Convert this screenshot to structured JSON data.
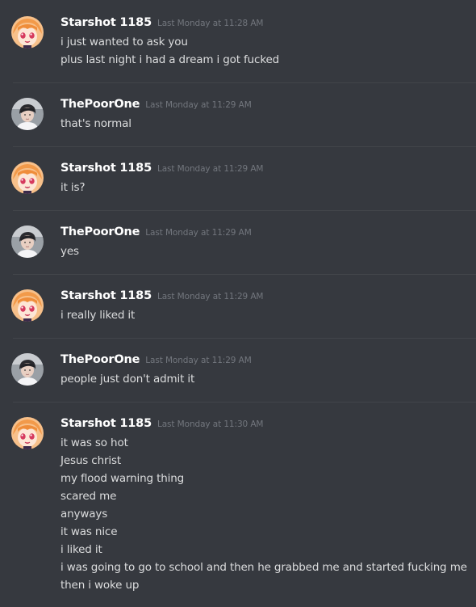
{
  "messages": [
    {
      "user": "Starshot 1185",
      "avatar": "anime-girl-avatar-icon",
      "timestamp": "Last Monday at 11:28 AM",
      "lines": [
        "i just wanted to ask you",
        "plus last night i had a dream i got fucked"
      ]
    },
    {
      "user": "ThePoorOne",
      "avatar": "boy-photo-avatar-icon",
      "timestamp": "Last Monday at 11:29 AM",
      "lines": [
        "that's normal"
      ]
    },
    {
      "user": "Starshot 1185",
      "avatar": "anime-girl-avatar-icon",
      "timestamp": "Last Monday at 11:29 AM",
      "lines": [
        "it is?"
      ]
    },
    {
      "user": "ThePoorOne",
      "avatar": "boy-photo-avatar-icon",
      "timestamp": "Last Monday at 11:29 AM",
      "lines": [
        "yes"
      ]
    },
    {
      "user": "Starshot 1185",
      "avatar": "anime-girl-avatar-icon",
      "timestamp": "Last Monday at 11:29 AM",
      "lines": [
        "i really liked it"
      ]
    },
    {
      "user": "ThePoorOne",
      "avatar": "boy-photo-avatar-icon",
      "timestamp": "Last Monday at 11:29 AM",
      "lines": [
        "people just don't admit it"
      ]
    },
    {
      "user": "Starshot 1185",
      "avatar": "anime-girl-avatar-icon",
      "timestamp": "Last Monday at 11:30 AM",
      "lines": [
        "it was so hot",
        "Jesus christ",
        "my flood warning thing",
        "scared me",
        "anyways",
        "it was nice",
        "i liked it",
        "i was going to go to school and then he grabbed me and started fucking me",
        "then i woke up"
      ]
    }
  ],
  "colors": {
    "background": "#36393f",
    "divider": "#42454a",
    "username": "#ffffff",
    "timestamp": "#72767d",
    "text": "#dcddde"
  }
}
